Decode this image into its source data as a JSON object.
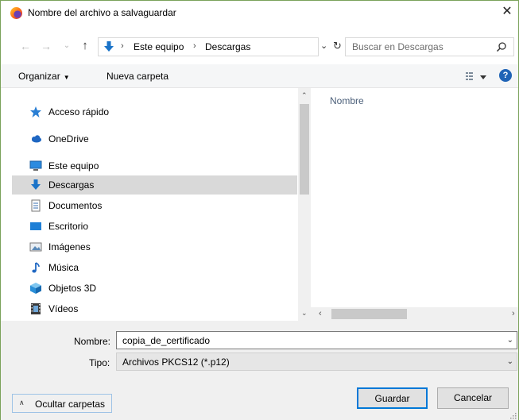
{
  "window": {
    "title": "Nombre del archivo a salvaguardar",
    "close_glyph": "✕",
    "app_icon": "firefox-icon"
  },
  "navigation": {
    "back_glyph": "←",
    "forward_glyph": "→",
    "recent_glyph": "⌄",
    "up_glyph": "↑",
    "breadcrumb": [
      "Este equipo",
      "Descargas"
    ],
    "breadcrumb_sep": "›",
    "dropdown_glyph": "⌄",
    "refresh_glyph": "↻",
    "search_placeholder": "Buscar en Descargas"
  },
  "toolbar": {
    "organize_label": "Organizar",
    "organize_caret": "▼",
    "new_folder_label": "Nueva carpeta",
    "help_glyph": "?"
  },
  "nav_pane": {
    "items": [
      {
        "label": "Acceso rápido",
        "icon": "star-icon",
        "selected": false
      },
      {
        "label": "OneDrive",
        "icon": "cloud-icon",
        "selected": false
      },
      {
        "label": "Este equipo",
        "icon": "computer-icon",
        "selected": false
      },
      {
        "label": "Descargas",
        "icon": "download-icon",
        "selected": true
      },
      {
        "label": "Documentos",
        "icon": "document-icon",
        "selected": false
      },
      {
        "label": "Escritorio",
        "icon": "desktop-icon",
        "selected": false
      },
      {
        "label": "Imágenes",
        "icon": "picture-icon",
        "selected": false
      },
      {
        "label": "Música",
        "icon": "music-icon",
        "selected": false
      },
      {
        "label": "Objetos 3D",
        "icon": "cube-icon",
        "selected": false
      },
      {
        "label": "Vídeos",
        "icon": "video-icon",
        "selected": false
      }
    ],
    "scroll_up_glyph": "⌃",
    "scroll_down_glyph": "⌄"
  },
  "content": {
    "column_name": "Nombre",
    "scroll_left_glyph": "‹",
    "scroll_right_glyph": "›"
  },
  "form": {
    "name_label": "Nombre:",
    "name_value": "copia_de_certificado",
    "type_label": "Tipo:",
    "type_value": "Archivos PKCS12 (*.p12)",
    "caret_glyph": "⌄"
  },
  "footer": {
    "hide_folders_glyph": "∧",
    "hide_folders_label": "Ocultar carpetas",
    "save_label": "Guardar",
    "cancel_label": "Cancelar"
  },
  "colors": {
    "accent": "#0078d7",
    "selection": "#d9d9d9",
    "help_blue": "#1f63b6",
    "column_header": "#4c607a"
  }
}
